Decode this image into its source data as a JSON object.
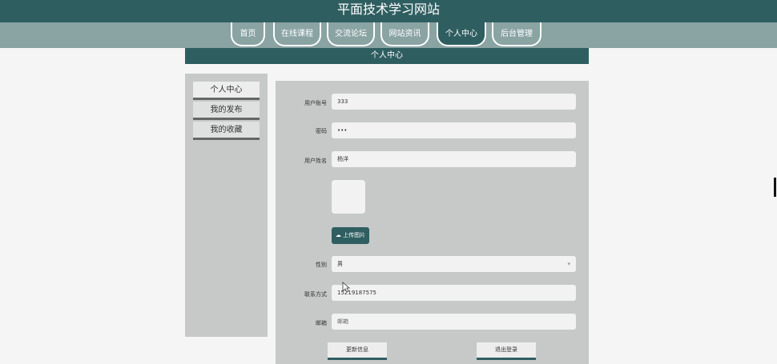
{
  "header": {
    "site_title": "平面技术学习网站"
  },
  "nav": {
    "items": [
      "首页",
      "在线课程",
      "交流论坛",
      "网站资讯",
      "个人中心",
      "后台管理"
    ],
    "active": "个人中心"
  },
  "section": {
    "title": "个人中心"
  },
  "sidebar": {
    "items": [
      "个人中心",
      "我的发布",
      "我的收藏"
    ],
    "active": "个人中心"
  },
  "form": {
    "account": {
      "label": "用户账号",
      "value": "333"
    },
    "password": {
      "label": "密码",
      "value": "•••"
    },
    "name": {
      "label": "用户姓名",
      "value": "杨洋"
    },
    "upload_label": "上传图片",
    "upload_icon": "cloud-upload-icon",
    "gender": {
      "label": "性别",
      "value": "男"
    },
    "phone": {
      "label": "联系方式",
      "value": "15219187575"
    },
    "email": {
      "label": "邮箱",
      "placeholder": "邮箱"
    }
  },
  "buttons": {
    "update": "更新信息",
    "logout": "退出登录"
  },
  "colors": {
    "primary": "#2f5e61",
    "nav_bg": "#8aa3a3",
    "panel_bg": "#c6c9c8",
    "page_bg": "#f5f5f5"
  }
}
